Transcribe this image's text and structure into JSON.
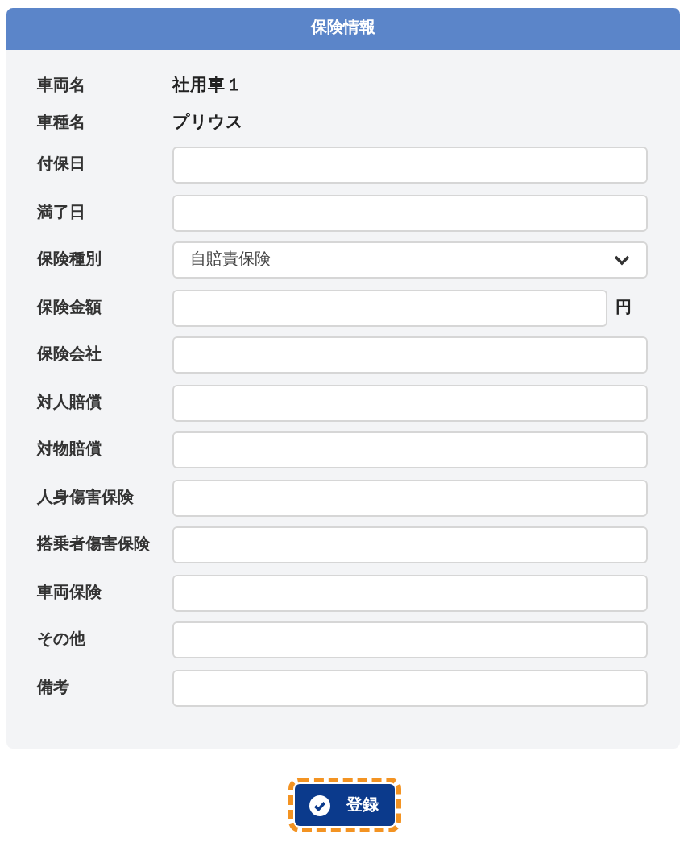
{
  "panel": {
    "title": "保険情報",
    "rows": [
      {
        "kind": "static",
        "label": "車両名",
        "value": "社用車１"
      },
      {
        "kind": "static",
        "label": "車種名",
        "value": "プリウス"
      },
      {
        "kind": "text",
        "label": "付保日"
      },
      {
        "kind": "text",
        "label": "満了日"
      },
      {
        "kind": "select",
        "label": "保険種別",
        "value": "自賠責保険"
      },
      {
        "kind": "text",
        "label": "保険金額",
        "suffix": "円"
      },
      {
        "kind": "text",
        "label": "保険会社"
      },
      {
        "kind": "text",
        "label": "対人賠償"
      },
      {
        "kind": "text",
        "label": "対物賠償"
      },
      {
        "kind": "text",
        "label": "人身傷害保険"
      },
      {
        "kind": "text",
        "label": "搭乗者傷害保険"
      },
      {
        "kind": "text",
        "label": "車両保険"
      },
      {
        "kind": "text",
        "label": "その他"
      },
      {
        "kind": "text",
        "label": "備考"
      }
    ]
  },
  "submit": {
    "label": "登録",
    "highlighted": true
  }
}
